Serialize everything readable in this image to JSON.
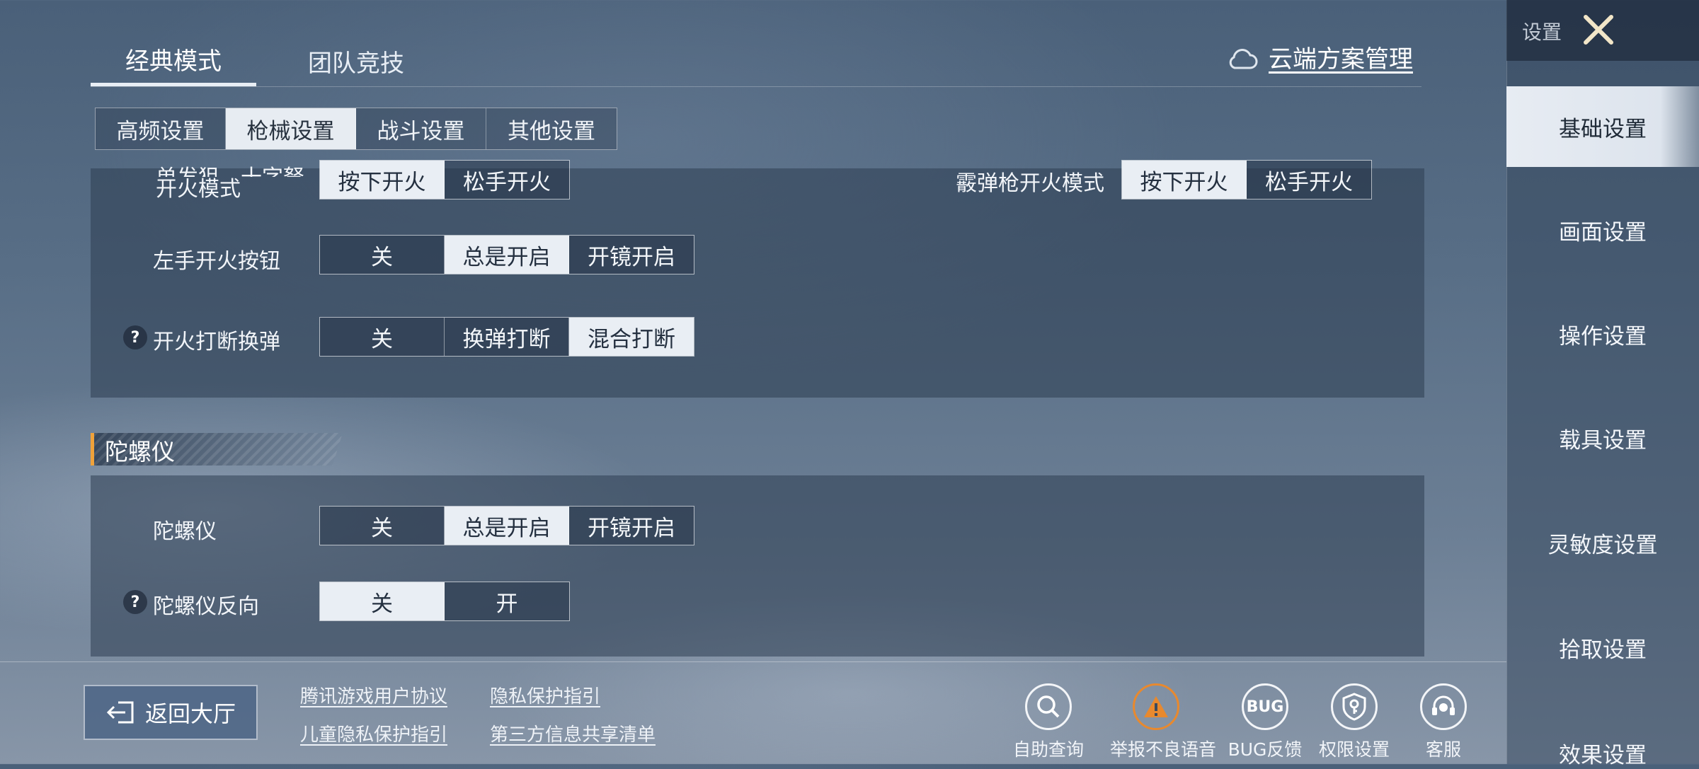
{
  "mode_tabs": [
    {
      "label": "经典模式",
      "active": true
    },
    {
      "label": "团队竞技",
      "active": false
    }
  ],
  "cloud_plan": {
    "label": "云端方案管理",
    "icon": "cloud-icon"
  },
  "sub_tabs": [
    {
      "label": "高频设置",
      "active": false
    },
    {
      "label": "枪械设置",
      "active": true
    },
    {
      "label": "战斗设置",
      "active": false
    },
    {
      "label": "其他设置",
      "active": false
    }
  ],
  "firing": {
    "single_shot_label_line1": "单发狙、十字弩",
    "single_shot_label_line2": "开火模式",
    "single_shot_options": [
      "按下开火",
      "松手开火"
    ],
    "shotgun_label": "霰弹枪开火模式",
    "shotgun_options": [
      "按下开火",
      "松手开火"
    ],
    "left_fire_label": "左手开火按钮",
    "left_fire_options": [
      "关",
      "总是开启",
      "开镜开启"
    ],
    "left_fire_selected": "总是开启",
    "interrupt_label": "开火打断换弹",
    "interrupt_options": [
      "关",
      "换弹打断",
      "混合打断"
    ],
    "interrupt_selected": "混合打断"
  },
  "gyro_section": {
    "title": "陀螺仪",
    "gyro_label": "陀螺仪",
    "gyro_options": [
      "关",
      "总是开启",
      "开镜开启"
    ],
    "gyro_selected": "总是开启",
    "reverse_label": "陀螺仪反向",
    "reverse_options": [
      "关",
      "开"
    ],
    "reverse_selected": "关"
  },
  "help_glyph": "?",
  "bottom": {
    "back_label": "返回大厅",
    "links": [
      "腾讯游戏用户协议",
      "隐私保护指引",
      "儿童隐私保护指引",
      "第三方信息共享清单"
    ],
    "utilities": [
      {
        "label": "自助查询",
        "icon": "search-icon"
      },
      {
        "label": "举报不良语音",
        "icon": "report-voice-icon"
      },
      {
        "label": "BUG反馈",
        "icon": "bug-icon",
        "glyph": "BUG"
      },
      {
        "label": "权限设置",
        "icon": "shield-key-icon"
      },
      {
        "label": "客服",
        "icon": "headset-icon"
      }
    ]
  },
  "sidebar": {
    "title": "设置",
    "items": [
      {
        "label": "基础设置",
        "active": true
      },
      {
        "label": "画面设置",
        "active": false
      },
      {
        "label": "操作设置",
        "active": false
      },
      {
        "label": "载具设置",
        "active": false
      },
      {
        "label": "灵敏度设置",
        "active": false
      },
      {
        "label": "拾取设置",
        "active": false
      },
      {
        "label": "效果设置",
        "active": false
      }
    ]
  },
  "colors": {
    "accent": "#f0a23a",
    "selected_bg": "#e9eef4",
    "warn": "#e8892e"
  }
}
